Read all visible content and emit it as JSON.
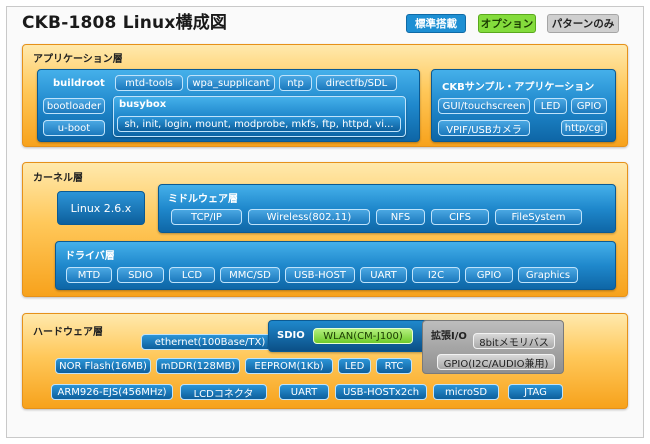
{
  "title": "CKB-1808 Linux構成図",
  "legend": {
    "standard": "標準搭載",
    "option": "オプション",
    "pattern": "パターンのみ"
  },
  "colors": {
    "standard": "#1d8fd3",
    "option": "#84dc3c",
    "pattern": "#cfcfcf",
    "layer": "#f7a21c"
  },
  "app_layer": {
    "title": "アプリケーション層",
    "buildroot": {
      "label": "buildroot",
      "chips": [
        "mtd-tools",
        "wpa_supplicant",
        "ntp",
        "directfb/SDL",
        "bootloader",
        "u-boot"
      ],
      "busybox": {
        "label": "busybox",
        "commands": "sh, init, login, mount, modprobe, mkfs, ftp, httpd, vi..."
      }
    },
    "ckb_apps": {
      "label": "CKBサンプル・アプリケーション",
      "chips": [
        "GUI/touchscreen",
        "LED",
        "GPIO",
        "VPIF/USBカメラ",
        "http/cgi"
      ]
    }
  },
  "kernel_layer": {
    "title": "カーネル層",
    "linux": "Linux 2.6.x",
    "middleware": {
      "label": "ミドルウェア層",
      "chips": [
        "TCP/IP",
        "Wireless(802.11)",
        "NFS",
        "CIFS",
        "FileSystem"
      ]
    },
    "drivers": {
      "label": "ドライバ層",
      "chips": [
        "MTD",
        "SDIO",
        "LCD",
        "MMC/SD",
        "USB-HOST",
        "UART",
        "I2C",
        "GPIO",
        "Graphics"
      ]
    }
  },
  "hw_layer": {
    "title": "ハードウェア層",
    "ethernet": "ethernet(100Base/TX)",
    "sdio": {
      "label": "SDIO",
      "option": "WLAN(CM-J100)"
    },
    "ext_io": {
      "label": "拡張I/O",
      "chips": [
        "8bitメモリバス",
        "GPIO(I2C/AUDIO兼用)"
      ]
    },
    "row1": [
      "NOR Flash(16MB)",
      "mDDR(128MB)",
      "EEPROM(1Kb)",
      "LED",
      "RTC"
    ],
    "row2": [
      "ARM926-EJS(456MHz)",
      "LCDコネクタ",
      "UART",
      "USB-HOSTx2ch",
      "microSD",
      "JTAG"
    ]
  }
}
